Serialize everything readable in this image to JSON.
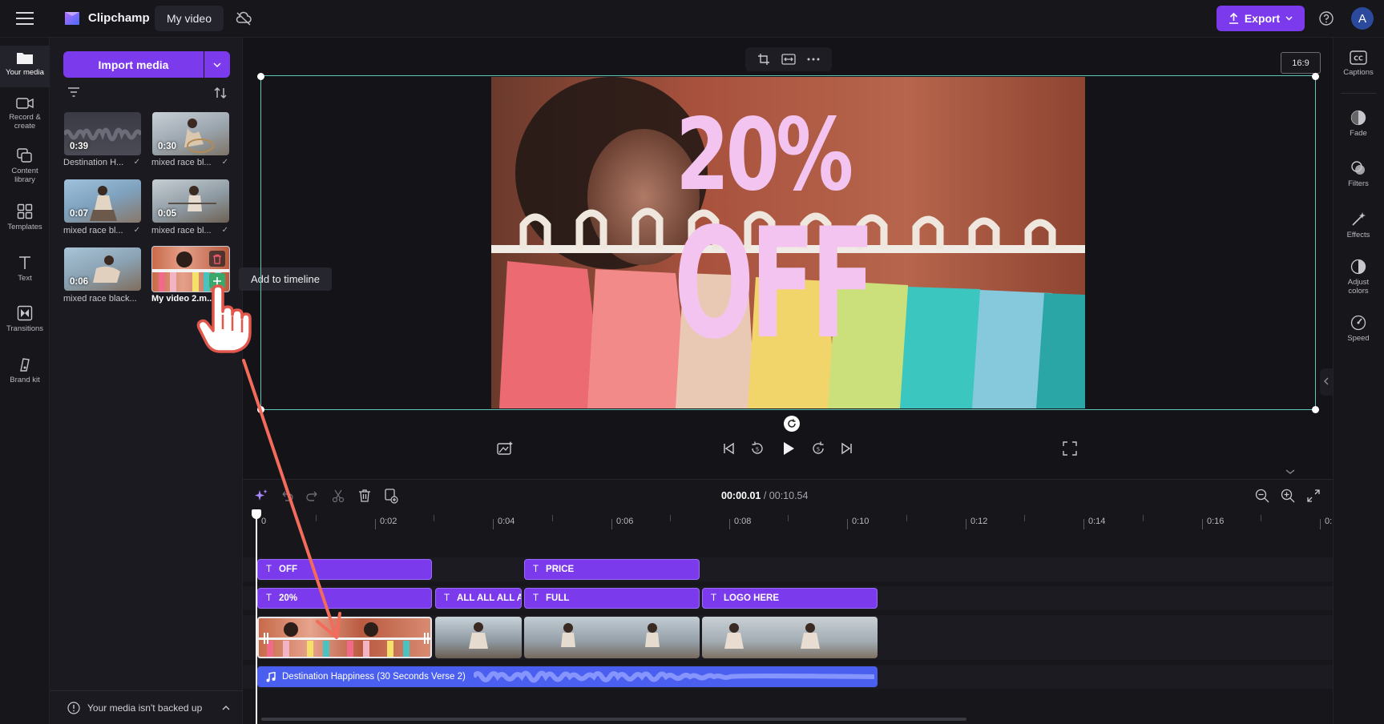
{
  "app": {
    "brand": "Clipchamp",
    "project_title": "My video"
  },
  "topbar": {
    "export_label": "Export",
    "avatar_initial": "A"
  },
  "leftnav": [
    {
      "label": "Your media",
      "icon": "folder-icon"
    },
    {
      "label": "Record &",
      "label2": "create",
      "icon": "camera-icon"
    },
    {
      "label": "Content",
      "label2": "library",
      "icon": "library-icon"
    },
    {
      "label": "Templates",
      "icon": "templates-icon"
    },
    {
      "label": "Text",
      "icon": "text-icon"
    },
    {
      "label": "Transitions",
      "icon": "transitions-icon"
    },
    {
      "label": "Brand kit",
      "icon": "brand-kit-icon"
    }
  ],
  "media": {
    "import_label": "Import media",
    "items": [
      {
        "duration": "0:39",
        "name": "Destination H...",
        "checked": true
      },
      {
        "duration": "0:30",
        "name": "mixed race bl...",
        "checked": true
      },
      {
        "duration": "0:07",
        "name": "mixed race bl...",
        "checked": true
      },
      {
        "duration": "0:05",
        "name": "mixed race bl...",
        "checked": true
      },
      {
        "duration": "0:06",
        "name": "mixed race black...",
        "checked": false
      },
      {
        "duration": "",
        "name": "My video 2.m...",
        "checked": false
      }
    ],
    "tooltip": "Add to timeline",
    "backup_notice": "Your media isn't backed up"
  },
  "preview": {
    "aspect_ratio": "16:9",
    "overlay_line1": "20%",
    "overlay_line2": "OFF",
    "overlay_color": "#f2c4ef"
  },
  "rightpanel": [
    {
      "label": "Captions",
      "icon": "captions-icon"
    },
    {
      "label": "Fade",
      "icon": "fade-icon"
    },
    {
      "label": "Filters",
      "icon": "filters-icon"
    },
    {
      "label": "Effects",
      "icon": "effects-icon"
    },
    {
      "label": "Adjust",
      "label2": "colors",
      "icon": "adjust-colors-icon"
    },
    {
      "label": "Speed",
      "icon": "speed-icon"
    }
  ],
  "timeline": {
    "current_time": "00:00.01",
    "total_time": "/ 00:10.54",
    "ruler": [
      "0",
      "0:02",
      "0:04",
      "0:06",
      "0:08",
      "0:10",
      "0:12",
      "0:14",
      "0:16",
      "0:"
    ],
    "text_row1": [
      "OFF",
      "PRICE"
    ],
    "text_row2": [
      "20%",
      "ALL ALL ALL A",
      "FULL",
      "LOGO HERE"
    ],
    "audio_label": "Destination Happiness (30 Seconds Verse 2)"
  },
  "colors": {
    "accent": "#7c3aed",
    "audio": "#4a5ff0",
    "selection": "#5fc7b7",
    "tooltip_arrow": "#f26b5b"
  }
}
